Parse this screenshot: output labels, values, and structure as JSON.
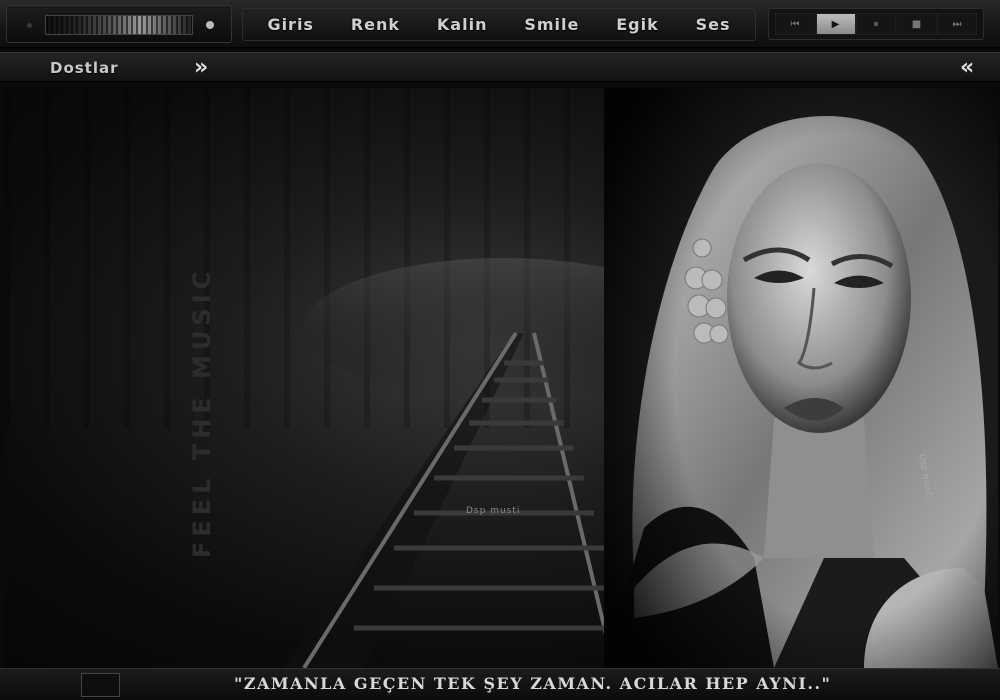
{
  "menu": {
    "items": [
      "Giris",
      "Renk",
      "Kalin",
      "Smile",
      "Egik",
      "Ses"
    ]
  },
  "player": {
    "buttons": [
      "prev",
      "play",
      "pause",
      "stop",
      "next"
    ],
    "active": "play"
  },
  "nav": {
    "title": "Dostlar"
  },
  "scene": {
    "vertical_text": "FEEL THE MUSIC",
    "watermark": "Dsp musti",
    "watermark2": "Dsp musti"
  },
  "footer": {
    "quote": "\"ZAMANLA GEÇEN TEK ŞEY ZAMAN. ACILAR HEP AYNI..\""
  },
  "colors": {
    "background": "#0a0a0a",
    "text": "#cfcfcf",
    "active_button": "#bdbdbd"
  }
}
